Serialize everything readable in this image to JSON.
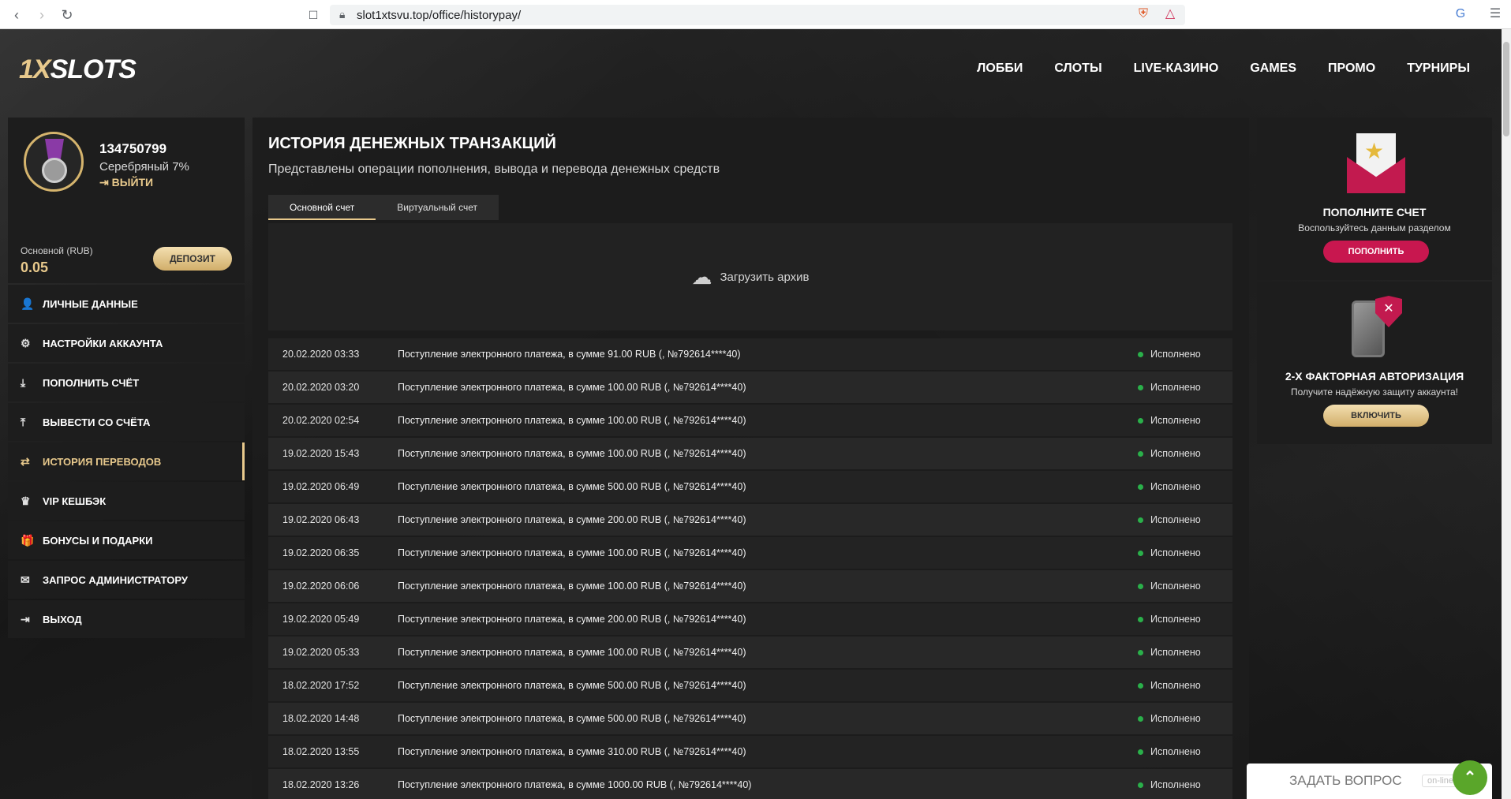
{
  "browser": {
    "url": "slot1xtsvu.top/office/historypay/"
  },
  "header": {
    "logo_accent": "1X",
    "logo_main": "SLOTS",
    "nav": [
      "ЛОББИ",
      "СЛОТЫ",
      "LIVE-КАЗИНО",
      "GAMES",
      "ПРОМО",
      "ТУРНИРЫ"
    ]
  },
  "profile": {
    "user_id": "134750799",
    "level": "Серебряный 7%",
    "logout": "ВЫЙТИ",
    "balance_label": "Основной (RUB)",
    "balance_value": "0.05",
    "deposit_button": "ДЕПОЗИТ"
  },
  "menu": [
    {
      "label": "ЛИЧНЫЕ ДАННЫЕ",
      "icon": "user-icon",
      "glyph": "👤"
    },
    {
      "label": "НАСТРОЙКИ АККАУНТА",
      "icon": "gear-icon",
      "glyph": "⚙"
    },
    {
      "label": "ПОПОЛНИТЬ СЧЁТ",
      "icon": "download-icon",
      "glyph": "⤓"
    },
    {
      "label": "ВЫВЕСТИ СО СЧЁТА",
      "icon": "upload-icon",
      "glyph": "⤒"
    },
    {
      "label": "ИСТОРИЯ ПЕРЕВОДОВ",
      "icon": "transfer-icon",
      "glyph": "⇄"
    },
    {
      "label": "VIP КЕШБЭК",
      "icon": "crown-icon",
      "glyph": "♛"
    },
    {
      "label": "БОНУСЫ И ПОДАРКИ",
      "icon": "gift-icon",
      "glyph": "🎁"
    },
    {
      "label": "ЗАПРОС АДМИНИСТРАТОРУ",
      "icon": "mail-icon",
      "glyph": "✉"
    },
    {
      "label": "ВЫХОД",
      "icon": "logout-icon",
      "glyph": "⇥"
    }
  ],
  "main": {
    "title": "ИСТОРИЯ ДЕНЕЖНЫХ ТРАНЗАКЦИЙ",
    "subtitle": "Представлены операции пополнения, вывода и перевода денежных средств",
    "tabs": [
      "Основной счет",
      "Виртуальный счет"
    ],
    "download_label": "Загрузить архив",
    "transactions": [
      {
        "date": "20.02.2020 03:33",
        "desc": "Поступление электронного платежа, в сумме 91.00 RUB (, №792614****40)",
        "status": "Исполнено"
      },
      {
        "date": "20.02.2020 03:20",
        "desc": "Поступление электронного платежа, в сумме 100.00 RUB (, №792614****40)",
        "status": "Исполнено"
      },
      {
        "date": "20.02.2020 02:54",
        "desc": "Поступление электронного платежа, в сумме 100.00 RUB (, №792614****40)",
        "status": "Исполнено"
      },
      {
        "date": "19.02.2020 15:43",
        "desc": "Поступление электронного платежа, в сумме 100.00 RUB (, №792614****40)",
        "status": "Исполнено"
      },
      {
        "date": "19.02.2020 06:49",
        "desc": "Поступление электронного платежа, в сумме 500.00 RUB (, №792614****40)",
        "status": "Исполнено"
      },
      {
        "date": "19.02.2020 06:43",
        "desc": "Поступление электронного платежа, в сумме 200.00 RUB (, №792614****40)",
        "status": "Исполнено"
      },
      {
        "date": "19.02.2020 06:35",
        "desc": "Поступление электронного платежа, в сумме 100.00 RUB (, №792614****40)",
        "status": "Исполнено"
      },
      {
        "date": "19.02.2020 06:06",
        "desc": "Поступление электронного платежа, в сумме 100.00 RUB (, №792614****40)",
        "status": "Исполнено"
      },
      {
        "date": "19.02.2020 05:49",
        "desc": "Поступление электронного платежа, в сумме 200.00 RUB (, №792614****40)",
        "status": "Исполнено"
      },
      {
        "date": "19.02.2020 05:33",
        "desc": "Поступление электронного платежа, в сумме 100.00 RUB (, №792614****40)",
        "status": "Исполнено"
      },
      {
        "date": "18.02.2020 17:52",
        "desc": "Поступление электронного платежа, в сумме 500.00 RUB (, №792614****40)",
        "status": "Исполнено"
      },
      {
        "date": "18.02.2020 14:48",
        "desc": "Поступление электронного платежа, в сумме 500.00 RUB (, №792614****40)",
        "status": "Исполнено"
      },
      {
        "date": "18.02.2020 13:55",
        "desc": "Поступление электронного платежа, в сумме 310.00 RUB (, №792614****40)",
        "status": "Исполнено"
      },
      {
        "date": "18.02.2020 13:26",
        "desc": "Поступление электронного платежа, в сумме 1000.00 RUB (, №792614****40)",
        "status": "Исполнено"
      }
    ]
  },
  "cards": {
    "deposit": {
      "title": "ПОПОЛНИТЕ СЧЕТ",
      "subtitle": "Воспользуйтесь данным разделом",
      "button": "ПОПОЛНИТЬ"
    },
    "twofa": {
      "title": "2-Х ФАКТОРНАЯ АВТОРИЗАЦИЯ",
      "subtitle": "Получите надёжную защиту аккаунта!",
      "button": "ВКЛЮЧИТЬ"
    }
  },
  "chat": {
    "label": "ЗАДАТЬ ВОПРОС",
    "status": "on-line"
  },
  "colors": {
    "accent_gold": "#e8c98c",
    "accent_red": "#c21a4f",
    "status_green": "#2ab04a"
  }
}
